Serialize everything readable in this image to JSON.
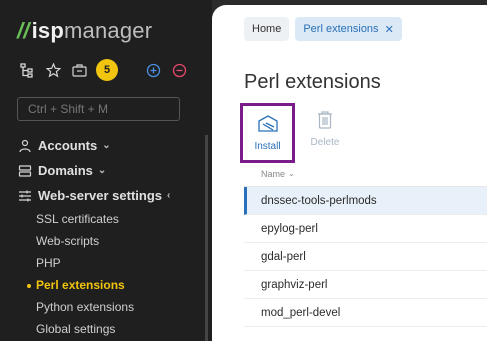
{
  "app": {
    "logo_slashes": "//",
    "logo_isp": "isp",
    "logo_manager": "manager",
    "notification_count": "5",
    "search_placeholder": "Ctrl + Shift + M"
  },
  "icons": {
    "tree": "tree-icon",
    "star": "star-icon",
    "briefcase": "briefcase-icon",
    "add": "plus-circle-icon",
    "remove": "minus-circle-icon",
    "accounts": "users-icon",
    "domains": "server-icon",
    "webserver": "sliders-icon"
  },
  "colors": {
    "sidebar_bg": "#1f1f1f",
    "accent_yellow": "#f1c40f",
    "link_blue": "#2a70b8",
    "highlight_purple": "#7a1b8a",
    "logo_green": "#6bbf59"
  },
  "sidebar": {
    "sections": [
      {
        "label": "Accounts",
        "chevron": "⌄"
      },
      {
        "label": "Domains",
        "chevron": "⌄"
      },
      {
        "label": "Web-server settings",
        "chevron": "‹"
      }
    ],
    "sub_items": [
      {
        "label": "SSL certificates"
      },
      {
        "label": "Web-scripts"
      },
      {
        "label": "PHP"
      },
      {
        "label": "Perl extensions"
      },
      {
        "label": "Python extensions"
      },
      {
        "label": "Global settings"
      }
    ]
  },
  "breadcrumb": {
    "home": "Home",
    "current": "Perl extensions",
    "close": "✕"
  },
  "page": {
    "title": "Perl extensions"
  },
  "toolbar": {
    "install": "Install",
    "delete": "Delete"
  },
  "table": {
    "column": "Name",
    "sort_indicator": "⌄",
    "rows": [
      "dnssec-tools-perlmods",
      "epylog-perl",
      "gdal-perl",
      "graphviz-perl",
      "mod_perl-devel"
    ]
  }
}
